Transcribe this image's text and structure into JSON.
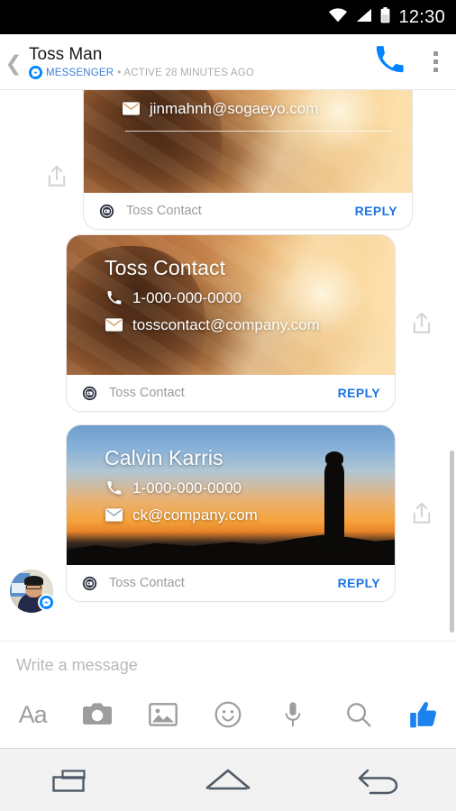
{
  "status_bar": {
    "time": "12:30",
    "icons": [
      "wifi-icon",
      "cellular-signal-icon",
      "battery-icon"
    ]
  },
  "header": {
    "back_icon": "chevron-left-icon",
    "title": "Toss Man",
    "brand": "MESSENGER",
    "subtitle_rest": "• ACTIVE 28 MINUTES AGO",
    "call_icon": "phone-icon",
    "overflow_icon": "more-vertical-icon",
    "accent_color": "#0084ff",
    "brand_color": "#3b7fd4"
  },
  "thread": {
    "share_icon": "share-upload-icon",
    "app_badge_icon": "toss-contact-app-icon",
    "phone_icon": "phone-icon",
    "email_icon": "envelope-icon",
    "reply_color": "#1b74e4",
    "messages": [
      {
        "name": "",
        "phone": "",
        "email": "jinmahnh@sogaeyo.com",
        "app_label": "Toss Contact",
        "reply_label": "REPLY",
        "image": "warm-sunset-portrait",
        "share_side": "left"
      },
      {
        "name": "Toss Contact",
        "phone": "1-000-000-0000",
        "email": "tosscontact@company.com",
        "app_label": "Toss Contact",
        "reply_label": "REPLY",
        "image": "warm-sunset-portrait",
        "share_side": "right"
      },
      {
        "name": "Calvin Karris",
        "phone": "1-000-000-0000",
        "email": "ck@company.com",
        "app_label": "Toss Contact",
        "reply_label": "REPLY",
        "image": "dusk-silhouette",
        "share_side": "right"
      }
    ],
    "avatar_name": "sender-avatar",
    "avatar_badge_icon": "messenger-badge-icon"
  },
  "composer": {
    "placeholder": "Write a message",
    "value": "",
    "tools": [
      {
        "icon": "text-format-icon",
        "label": "Aa"
      },
      {
        "icon": "camera-icon",
        "label": ""
      },
      {
        "icon": "photo-gallery-icon",
        "label": ""
      },
      {
        "icon": "emoji-smiley-icon",
        "label": ""
      },
      {
        "icon": "microphone-icon",
        "label": ""
      },
      {
        "icon": "search-icon",
        "label": ""
      },
      {
        "icon": "thumbs-up-icon",
        "label": ""
      }
    ],
    "thumb_color": "#1b82f0"
  },
  "navbar": {
    "buttons": [
      {
        "icon": "recents-icon"
      },
      {
        "icon": "home-icon"
      },
      {
        "icon": "back-icon"
      }
    ]
  }
}
